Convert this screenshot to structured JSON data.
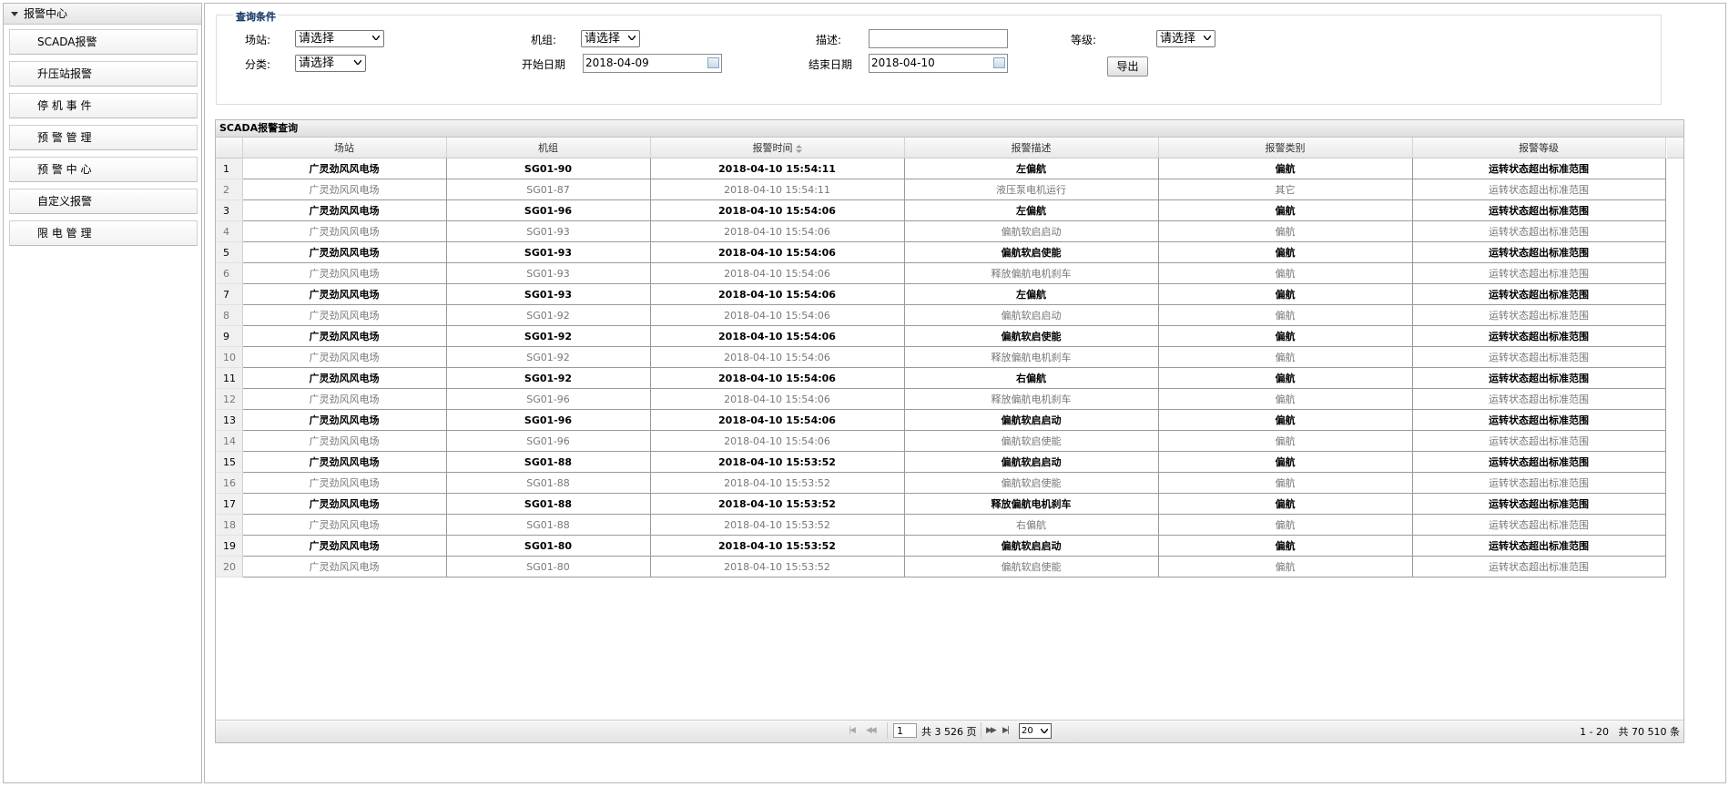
{
  "sidebar": {
    "header": "报警中心",
    "items": [
      {
        "label": "SCADA报警"
      },
      {
        "label": "升压站报警"
      },
      {
        "label": "停 机 事 件"
      },
      {
        "label": "预 警 管 理"
      },
      {
        "label": "预 警 中 心"
      },
      {
        "label": "自定义报警"
      },
      {
        "label": "限 电 管 理"
      }
    ]
  },
  "query": {
    "title": "查询条件",
    "station_label": "场站:",
    "station_value": "请选择",
    "unit_label": "机组:",
    "unit_value": "请选择",
    "desc_label": "描述:",
    "desc_value": "",
    "level_label": "等级:",
    "level_value": "请选择",
    "category_label": "分类:",
    "category_value": "请选择",
    "start_label": "开始日期",
    "start_value": "2018-04-09",
    "end_label": "结束日期",
    "end_value": "2018-04-10",
    "export_label": "导出"
  },
  "grid": {
    "title": "SCADA报警查询",
    "columns": [
      "场站",
      "机组",
      "报警时间",
      "报警描述",
      "报警类别",
      "报警等级"
    ],
    "rows": [
      {
        "n": "1",
        "station": "广灵劲风风电场",
        "unit": "SG01-90",
        "time": "2018-04-10 15:54:11",
        "desc": "左偏航",
        "cat": "偏航",
        "level": "运转状态超出标准范围"
      },
      {
        "n": "2",
        "station": "广灵劲风风电场",
        "unit": "SG01-87",
        "time": "2018-04-10 15:54:11",
        "desc": "液压泵电机运行",
        "cat": "其它",
        "level": "运转状态超出标准范围"
      },
      {
        "n": "3",
        "station": "广灵劲风风电场",
        "unit": "SG01-96",
        "time": "2018-04-10 15:54:06",
        "desc": "左偏航",
        "cat": "偏航",
        "level": "运转状态超出标准范围"
      },
      {
        "n": "4",
        "station": "广灵劲风风电场",
        "unit": "SG01-93",
        "time": "2018-04-10 15:54:06",
        "desc": "偏航软启启动",
        "cat": "偏航",
        "level": "运转状态超出标准范围"
      },
      {
        "n": "5",
        "station": "广灵劲风风电场",
        "unit": "SG01-93",
        "time": "2018-04-10 15:54:06",
        "desc": "偏航软启使能",
        "cat": "偏航",
        "level": "运转状态超出标准范围"
      },
      {
        "n": "6",
        "station": "广灵劲风风电场",
        "unit": "SG01-93",
        "time": "2018-04-10 15:54:06",
        "desc": "释放偏航电机刹车",
        "cat": "偏航",
        "level": "运转状态超出标准范围"
      },
      {
        "n": "7",
        "station": "广灵劲风风电场",
        "unit": "SG01-93",
        "time": "2018-04-10 15:54:06",
        "desc": "左偏航",
        "cat": "偏航",
        "level": "运转状态超出标准范围"
      },
      {
        "n": "8",
        "station": "广灵劲风风电场",
        "unit": "SG01-92",
        "time": "2018-04-10 15:54:06",
        "desc": "偏航软启启动",
        "cat": "偏航",
        "level": "运转状态超出标准范围"
      },
      {
        "n": "9",
        "station": "广灵劲风风电场",
        "unit": "SG01-92",
        "time": "2018-04-10 15:54:06",
        "desc": "偏航软启使能",
        "cat": "偏航",
        "level": "运转状态超出标准范围"
      },
      {
        "n": "10",
        "station": "广灵劲风风电场",
        "unit": "SG01-92",
        "time": "2018-04-10 15:54:06",
        "desc": "释放偏航电机刹车",
        "cat": "偏航",
        "level": "运转状态超出标准范围"
      },
      {
        "n": "11",
        "station": "广灵劲风风电场",
        "unit": "SG01-92",
        "time": "2018-04-10 15:54:06",
        "desc": "右偏航",
        "cat": "偏航",
        "level": "运转状态超出标准范围"
      },
      {
        "n": "12",
        "station": "广灵劲风风电场",
        "unit": "SG01-96",
        "time": "2018-04-10 15:54:06",
        "desc": "释放偏航电机刹车",
        "cat": "偏航",
        "level": "运转状态超出标准范围"
      },
      {
        "n": "13",
        "station": "广灵劲风风电场",
        "unit": "SG01-96",
        "time": "2018-04-10 15:54:06",
        "desc": "偏航软启启动",
        "cat": "偏航",
        "level": "运转状态超出标准范围"
      },
      {
        "n": "14",
        "station": "广灵劲风风电场",
        "unit": "SG01-96",
        "time": "2018-04-10 15:54:06",
        "desc": "偏航软启使能",
        "cat": "偏航",
        "level": "运转状态超出标准范围"
      },
      {
        "n": "15",
        "station": "广灵劲风风电场",
        "unit": "SG01-88",
        "time": "2018-04-10 15:53:52",
        "desc": "偏航软启启动",
        "cat": "偏航",
        "level": "运转状态超出标准范围"
      },
      {
        "n": "16",
        "station": "广灵劲风风电场",
        "unit": "SG01-88",
        "time": "2018-04-10 15:53:52",
        "desc": "偏航软启使能",
        "cat": "偏航",
        "level": "运转状态超出标准范围"
      },
      {
        "n": "17",
        "station": "广灵劲风风电场",
        "unit": "SG01-88",
        "time": "2018-04-10 15:53:52",
        "desc": "释放偏航电机刹车",
        "cat": "偏航",
        "level": "运转状态超出标准范围"
      },
      {
        "n": "18",
        "station": "广灵劲风风电场",
        "unit": "SG01-88",
        "time": "2018-04-10 15:53:52",
        "desc": "右偏航",
        "cat": "偏航",
        "level": "运转状态超出标准范围"
      },
      {
        "n": "19",
        "station": "广灵劲风风电场",
        "unit": "SG01-80",
        "time": "2018-04-10 15:53:52",
        "desc": "偏航软启启动",
        "cat": "偏航",
        "level": "运转状态超出标准范围"
      },
      {
        "n": "20",
        "station": "广灵劲风风电场",
        "unit": "SG01-80",
        "time": "2018-04-10 15:53:52",
        "desc": "偏航软启使能",
        "cat": "偏航",
        "level": "运转状态超出标准范围"
      }
    ]
  },
  "pager": {
    "current_page": "1",
    "total_pages_text": "共 3 526 页",
    "page_size": "20",
    "summary": "1 - 20   共 70 510 条"
  }
}
